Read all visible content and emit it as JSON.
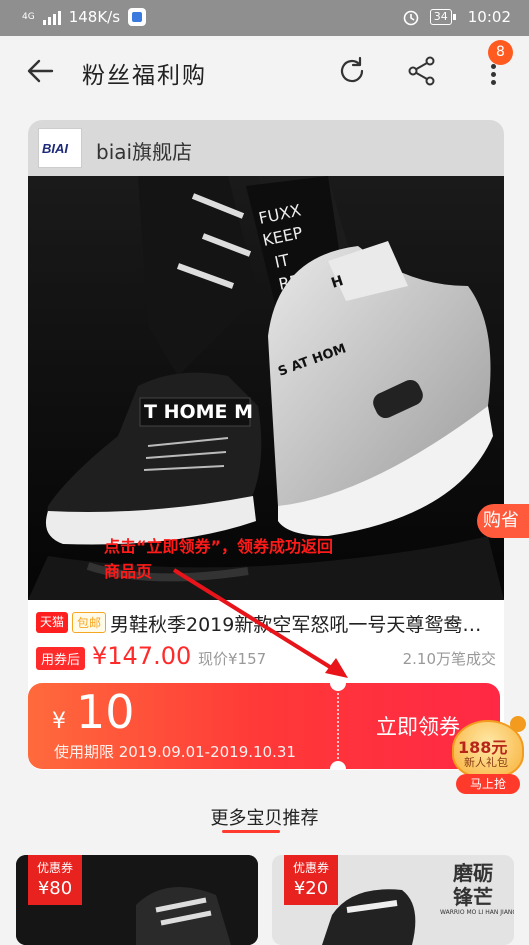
{
  "status_bar": {
    "network": "4G",
    "speed": "148K/s",
    "battery": "34",
    "time": "10:02"
  },
  "nav": {
    "title": "粉丝福利购",
    "menu_badge": "8"
  },
  "store": {
    "logo_text": "BIAI",
    "name": "biai旗舰店"
  },
  "product": {
    "image_overlay_texts": [
      "FUXX",
      "KEEP",
      "IT",
      "REAL",
      "T HOME M",
      "S AT HOM"
    ],
    "tags": [
      "天猫",
      "包邮"
    ],
    "title": "男鞋秋季2019新款空军怒吼一号天尊鸳鸯…",
    "price_label": "用券后",
    "price": "¥147.00",
    "original_price": "现价¥157",
    "sales": "2.10万笔成交"
  },
  "annotation": {
    "line1": "点击“立即领券”，领券成功返回",
    "line2": "商品页"
  },
  "coupon": {
    "currency": "¥",
    "amount": "10",
    "validity": "使用期限 2019.09.01-2019.10.31",
    "action_label": "立即领券"
  },
  "side_buy": {
    "label": "购省"
  },
  "gift": {
    "amount": "188元",
    "sub": "新人礼包",
    "button": "马上抢"
  },
  "recommend": {
    "title": "更多宝贝推荐",
    "items": [
      {
        "flag_label": "优惠券",
        "value": "¥80"
      },
      {
        "flag_label": "优惠券",
        "value": "¥20",
        "brand_text": "磨砺",
        "brand_text2": "锋芒",
        "brand_sub": "WARRIO MO LI HAN JIANG"
      }
    ]
  },
  "colors": {
    "accent": "#ff3b30",
    "coupon_start": "#ff6a3c",
    "coupon_end": "#ff2845",
    "status_bar": "#8f8f8f"
  }
}
